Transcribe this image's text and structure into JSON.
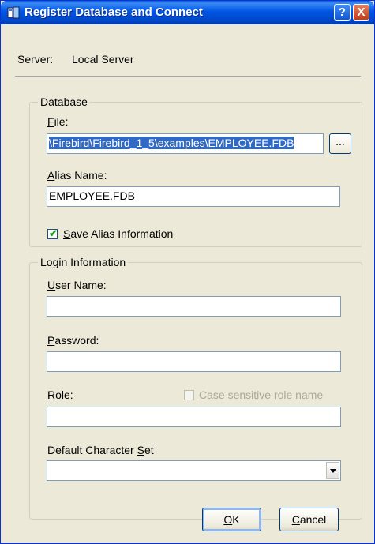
{
  "window": {
    "title": "Register Database and Connect",
    "help_label": "?",
    "close_label": "X"
  },
  "server": {
    "label": "Server:",
    "value": "Local Server"
  },
  "database": {
    "legend": "Database",
    "file_label_accel": "F",
    "file_label_rest": "ile:",
    "file_value": "\\Firebird\\Firebird_1_5\\examples\\EMPLOYEE.FDB",
    "browse_label": "...",
    "alias_label_accel": "A",
    "alias_label_rest": "lias Name:",
    "alias_value": "EMPLOYEE.FDB",
    "save_alias_accel": "S",
    "save_alias_rest": "ave Alias Information",
    "save_alias_checked": true
  },
  "login": {
    "legend": "Login Information",
    "user_label_accel": "U",
    "user_label_rest": "ser Name:",
    "user_value": "",
    "password_label_accel": "P",
    "password_label_rest": "assword:",
    "password_value": "",
    "role_label_accel": "R",
    "role_label_rest": "ole:",
    "role_value": "",
    "case_sensitive_accel": "C",
    "case_sensitive_rest": "ase sensitive role name",
    "charset_label_prefix": "Default Character ",
    "charset_label_accel": "S",
    "charset_label_rest": "et",
    "charset_value": ""
  },
  "buttons": {
    "ok_accel": "O",
    "ok_rest": "K",
    "cancel_accel": "C",
    "cancel_rest": "ancel"
  }
}
